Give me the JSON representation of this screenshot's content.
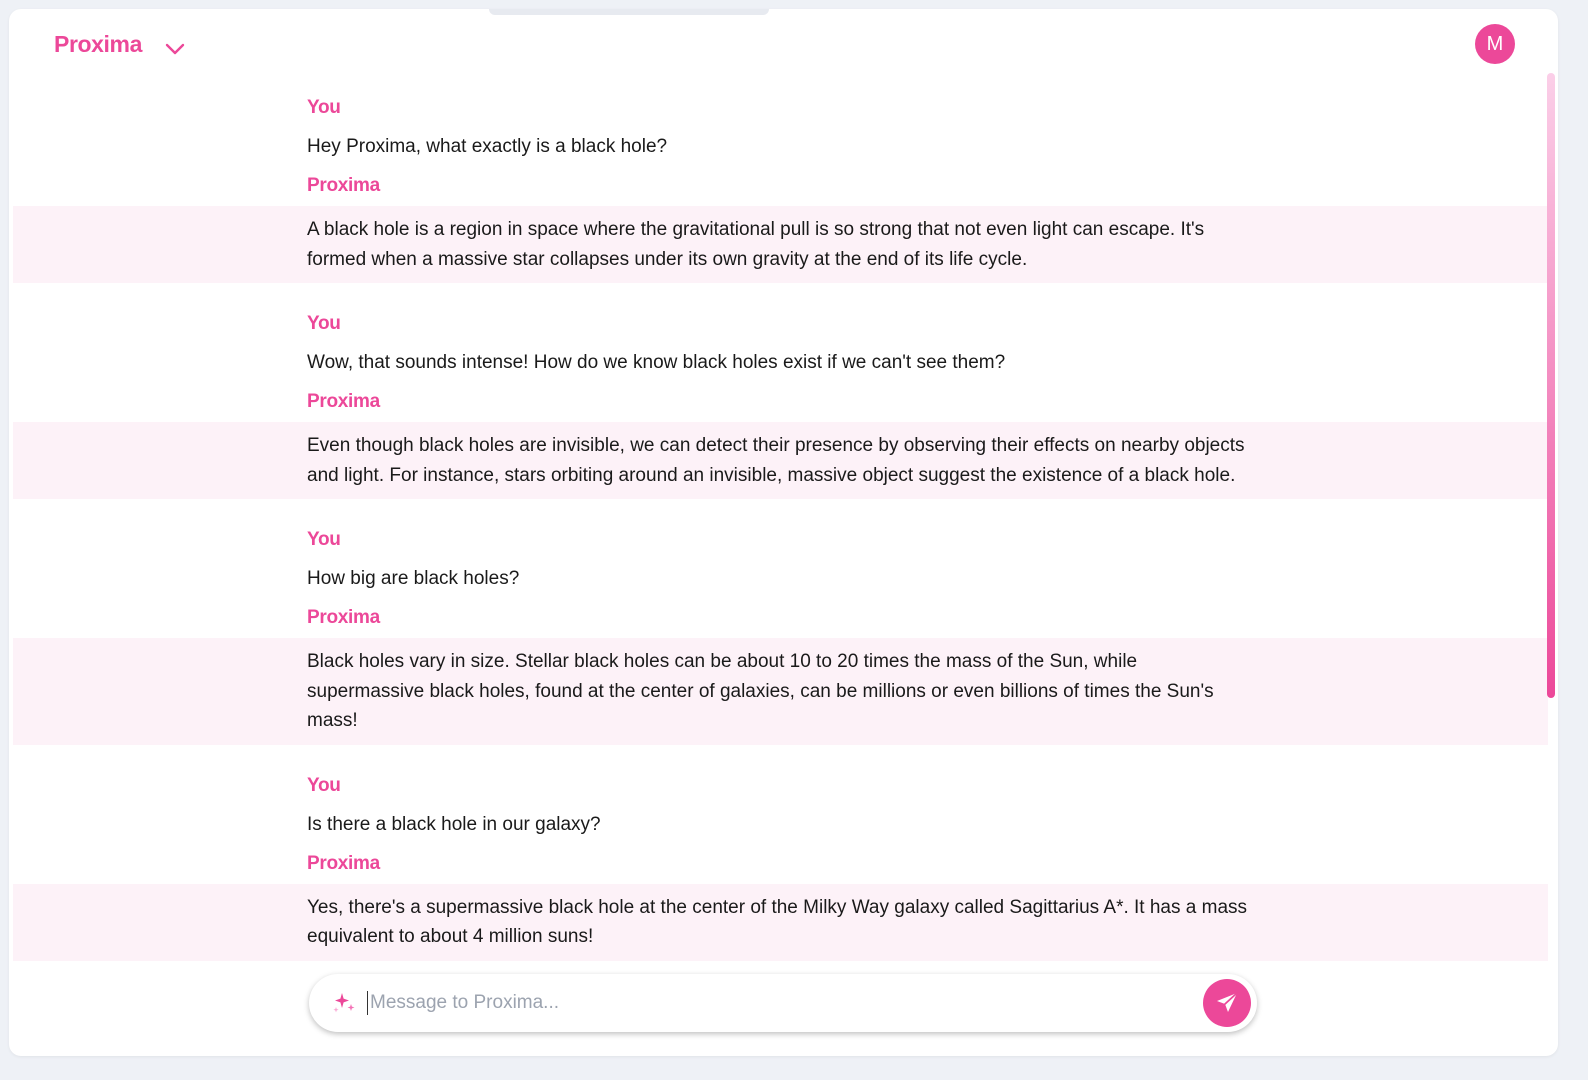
{
  "app": {
    "brand_name": "Proxima",
    "avatar_initial": "M",
    "accent_color": "#ec4899",
    "bot_bubble_color": "#fdf2f8"
  },
  "conversation": [
    {
      "user_label": "You",
      "user_text": "Hey Proxima, what exactly is a black hole?",
      "bot_label": "Proxima",
      "bot_text": "A black hole is a region in space where the gravitational pull is so strong that not even light can escape. It's formed when a massive star collapses under its own gravity at the end of its life cycle."
    },
    {
      "user_label": "You",
      "user_text": "Wow, that sounds intense! How do we know black holes exist if we can't see them?",
      "bot_label": "Proxima",
      "bot_text": "Even though black holes are invisible, we can detect their presence by observing their effects on nearby objects and light. For instance, stars orbiting around an invisible, massive object suggest the existence of a black hole."
    },
    {
      "user_label": "You",
      "user_text": "How big are black holes?",
      "bot_label": "Proxima",
      "bot_text": "Black holes vary in size. Stellar black holes can be about 10 to 20 times the mass of the Sun, while supermassive black holes, found at the center of galaxies, can be millions or even billions of times the Sun's mass!"
    },
    {
      "user_label": "You",
      "user_text": "Is there a black hole in our galaxy?",
      "bot_label": "Proxima",
      "bot_text": "Yes, there's a supermassive black hole at the center of the Milky Way galaxy called Sagittarius A*. It has a mass equivalent to about 4 million suns!"
    }
  ],
  "composer": {
    "placeholder": "Message to Proxima...",
    "value": "",
    "sparkle_icon": "sparkles-icon",
    "send_icon": "paper-plane-icon"
  }
}
